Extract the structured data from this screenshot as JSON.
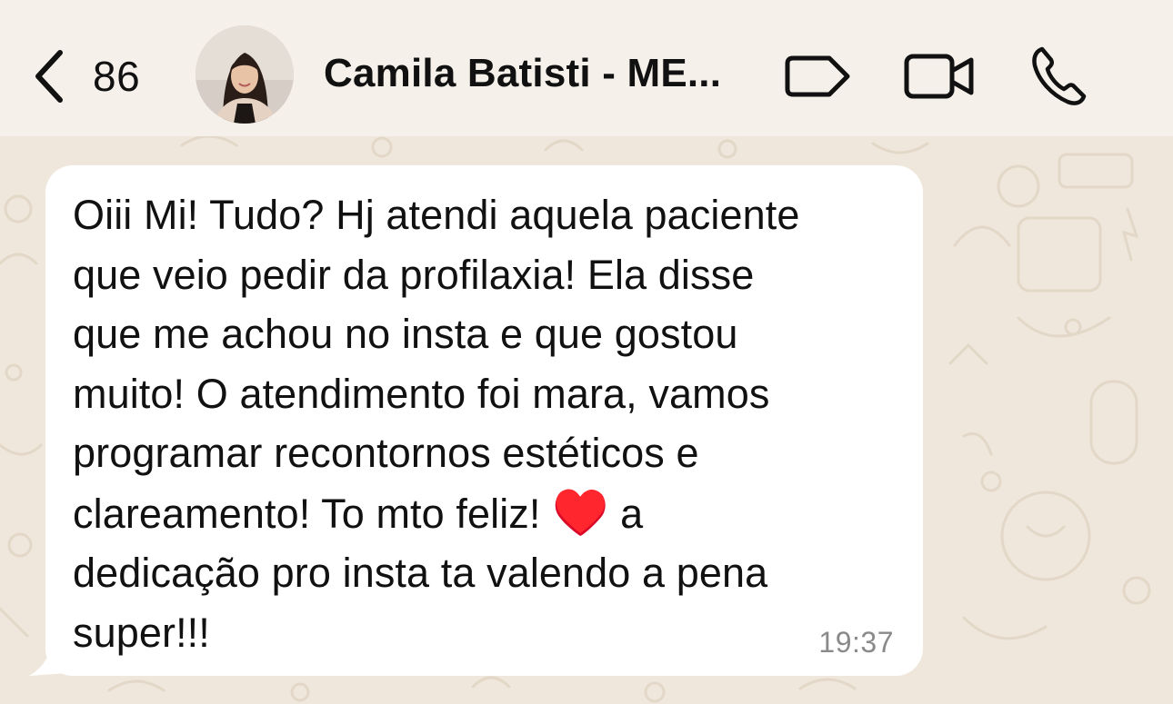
{
  "header": {
    "back_count": "86",
    "contact_name": "Camila Batisti - ME...",
    "icons": [
      "back-chevron-icon",
      "label-tag-icon",
      "video-call-icon",
      "phone-call-icon"
    ]
  },
  "message": {
    "text_part1": "Oiii Mi! Tudo? Hj atendi aquela paciente\nque veio pedir da profilaxia! Ela disse\nque me achou no insta e que gostou\nmuito! O atendimento foi mara, vamos\nprogramar recontornos estéticos e\nclareamento! To mto feliz! ",
    "emoji": "♥️",
    "text_part2": " a\ndedicação pro insta ta valendo a pena\nsuper!!!",
    "time": "19:37"
  },
  "colors": {
    "header_bg": "#f5f1ea",
    "chat_bg": "#efe7dc",
    "bubble_bg": "#ffffff",
    "text": "#111111",
    "time": "#8a8a8a",
    "heart": "#e0142a"
  }
}
